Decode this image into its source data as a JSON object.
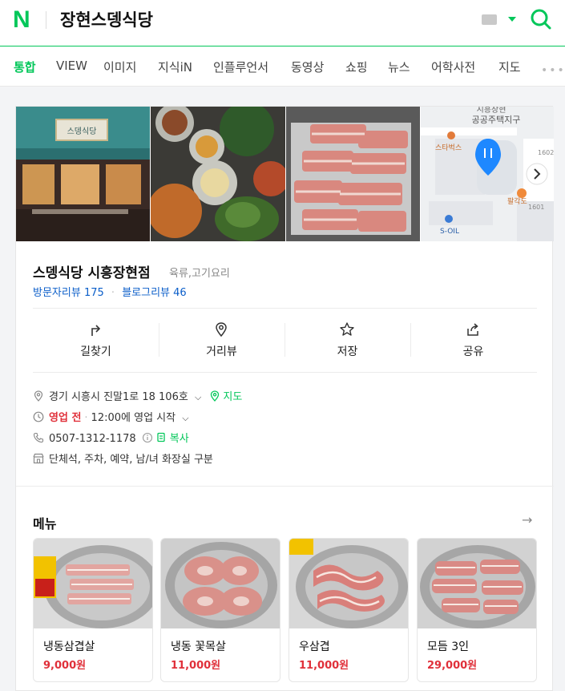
{
  "header": {
    "logo": "N",
    "query": "장현스뎅식당"
  },
  "tabs": [
    "통합",
    "VIEW",
    "이미지",
    "지식iN",
    "인플루언서",
    "동영상",
    "쇼핑",
    "뉴스",
    "어학사전",
    "지도"
  ],
  "tabs_more": "•••",
  "place": {
    "name": "스뎅식당 시흥장현점",
    "category": "육류,고기요리",
    "visitor_review_label": "방문자리뷰",
    "visitor_review_count": "175",
    "blog_review_label": "블로그리뷰",
    "blog_review_count": "46",
    "sign_text": "스뎅식당",
    "map": {
      "label_area_1": "시흥장현",
      "label_area_2": "공공주택지구",
      "label_starbucks": "스타벅스",
      "label_soil": "S-OIL",
      "label_palgakdo": "팔각도",
      "label_1602": "1602",
      "label_1601": "1601"
    }
  },
  "actions": [
    {
      "label": "길찾기",
      "icon": "directions-icon"
    },
    {
      "label": "거리뷰",
      "icon": "street-view-icon"
    },
    {
      "label": "저장",
      "icon": "star-icon"
    },
    {
      "label": "공유",
      "icon": "share-icon"
    }
  ],
  "info": {
    "address": "경기 시흥시 진말1로 18 106호",
    "map_link": "지도",
    "status": "영업 전",
    "hours": "12:00에 영업 시작",
    "phone": "0507-1312-1178",
    "copy": "복사",
    "amenities": "단체석, 주차, 예약, 남/녀 화장실 구분"
  },
  "menu": {
    "title": "메뉴",
    "items": [
      {
        "name": "냉동삼겹살",
        "price": "9,000원"
      },
      {
        "name": "냉동 꽃목살",
        "price": "11,000원"
      },
      {
        "name": "우삼겹",
        "price": "11,000원"
      },
      {
        "name": "모듬 3인",
        "price": "29,000원"
      }
    ]
  },
  "colors": {
    "accent": "#03c75a",
    "link": "#0b5ec9",
    "price": "#e0303a"
  }
}
